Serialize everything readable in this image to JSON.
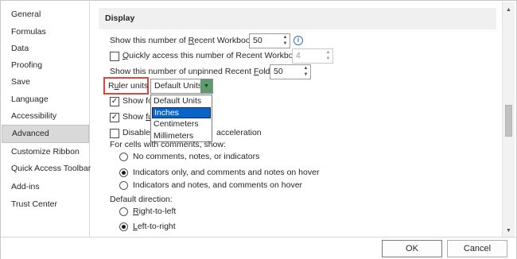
{
  "sidebar": {
    "items": [
      {
        "label": "General"
      },
      {
        "label": "Formulas"
      },
      {
        "label": "Data"
      },
      {
        "label": "Proofing"
      },
      {
        "label": "Save"
      },
      {
        "label": "Language"
      },
      {
        "label": "Accessibility"
      },
      {
        "label": "Advanced",
        "selected": true
      },
      {
        "label": "Customize Ribbon"
      },
      {
        "label": "Quick Access Toolbar"
      },
      {
        "label": "Add-ins"
      },
      {
        "label": "Trust Center"
      }
    ]
  },
  "display": {
    "header": "Display",
    "recent_workbooks": {
      "pre": "Show this number of ",
      "underlined": "R",
      "post": "ecent Workbooks:",
      "value": "50"
    },
    "quick_access": {
      "underlined": "Q",
      "post": "uickly access this number of Recent Workbooks:",
      "value": "4",
      "checked": false
    },
    "recent_folders": {
      "pre": "Show this number of unpinned Recent ",
      "underlined": "F",
      "post": "olders:",
      "value": "50"
    },
    "ruler_units": {
      "pre": "R",
      "underlined": "u",
      "post": "ler units",
      "value": "Default Units"
    },
    "ruler_options": [
      "Default Units",
      "Inches",
      "Centimeters",
      "Millimeters"
    ],
    "ruler_highlight_index": 1,
    "show_formula": {
      "pre": "Show for",
      "checked": true
    },
    "show_function": {
      "pre": "Show ",
      "underlined": "fu",
      "checked": true
    },
    "disable_hw": {
      "pre": "Disable h",
      "post": "acceleration",
      "checked": false
    },
    "comments_label": "For cells with comments, show:",
    "comments_options": [
      {
        "label": "No comments, notes, or indicators",
        "checked": false
      },
      {
        "label": "Indicators only, and comments and notes on hover",
        "checked": true
      },
      {
        "label": "Indicators and notes, and comments on hover",
        "checked": false
      }
    ],
    "direction_label": "Default direction:",
    "direction_options": [
      {
        "underlined": "R",
        "post": "ight-to-left",
        "checked": false
      },
      {
        "underlined": "L",
        "post": "eft-to-right",
        "checked": true
      }
    ]
  },
  "footer": {
    "ok": "OK",
    "cancel": "Cancel"
  },
  "icons": {
    "info": "info-icon",
    "check": "checkmark-icon",
    "arrow_down": "chevron-down-icon"
  },
  "colors": {
    "highlight": "#0a64c8",
    "annotation": "#e0453b",
    "dropdown_button": "#5e9b6f"
  }
}
